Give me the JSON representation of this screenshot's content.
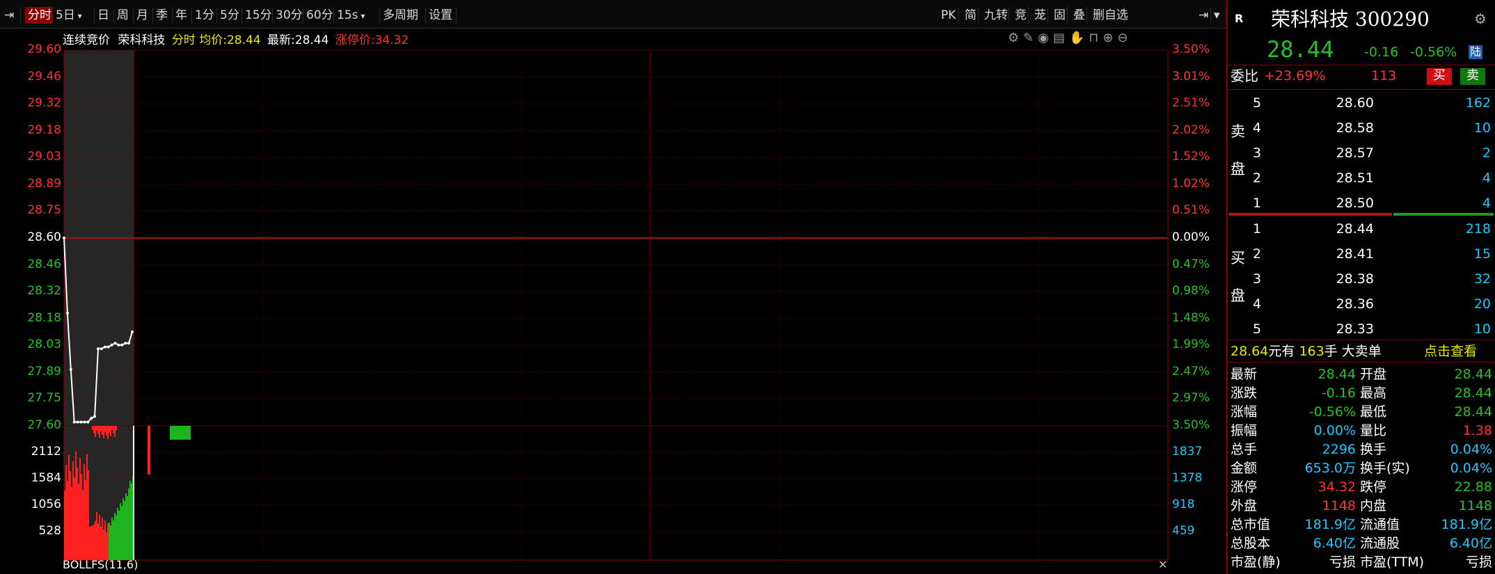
{
  "toolbar": {
    "tabs": [
      {
        "label": "分时",
        "active": true
      },
      {
        "label": "5日",
        "dropdown": true
      },
      {
        "label": "日"
      },
      {
        "label": "周"
      },
      {
        "label": "月"
      },
      {
        "label": "季"
      },
      {
        "label": "年"
      },
      {
        "label": "1分"
      },
      {
        "label": "5分"
      },
      {
        "label": "15分"
      },
      {
        "label": "30分"
      },
      {
        "label": "60分"
      },
      {
        "label": "15s",
        "dropdown": true
      },
      {
        "label": "多周期"
      },
      {
        "label": "设置"
      }
    ],
    "right_buttons": [
      "PK",
      "简",
      "九转",
      "竞",
      "茏",
      "固",
      "叠",
      "删自选"
    ]
  },
  "chart_header": {
    "auction_label": "连续竞价",
    "stock_name": "荣科科技",
    "mode": "分时",
    "avg_label": "均价:",
    "avg_value": "28.44",
    "latest_label": "最新:",
    "latest_value": "28.44",
    "limit_label": "涨停价:",
    "limit_value": "34.32"
  },
  "indicator_label": "BOLLFS(11,6)",
  "chart_data": {
    "type": "line",
    "price_axis": [
      "29.60",
      "29.46",
      "29.32",
      "29.18",
      "29.03",
      "28.89",
      "28.75",
      "28.60",
      "28.46",
      "28.32",
      "28.18",
      "28.03",
      "27.89",
      "27.75",
      "27.60"
    ],
    "pct_axis": [
      "3.50%",
      "3.01%",
      "2.51%",
      "2.02%",
      "1.52%",
      "1.02%",
      "0.51%",
      "0.00%",
      "0.47%",
      "0.98%",
      "1.48%",
      "1.99%",
      "2.47%",
      "2.97%",
      "3.50%"
    ],
    "prev_close": 28.6,
    "ylim": [
      27.6,
      29.6
    ],
    "price_series": [
      28.6,
      28.2,
      27.9,
      27.62,
      27.62,
      27.62,
      27.62,
      27.62,
      27.64,
      27.65,
      28.01,
      28.01,
      28.02,
      28.02,
      28.03,
      28.04,
      28.03,
      28.03,
      28.04,
      28.04,
      28.1
    ],
    "volume_axis_left": [
      "2112",
      "1584",
      "1056",
      "528"
    ],
    "volume_axis_right": [
      "1837",
      "1378",
      "918",
      "459"
    ],
    "volume_ylim": [
      0,
      2640
    ]
  },
  "quote": {
    "badge": "R",
    "name": "荣科科技",
    "code": "300290",
    "price": "28.44",
    "change": "-0.16",
    "change_pct": "-0.56%",
    "tag": "陆"
  },
  "order_ratio": {
    "label": "委比",
    "value": "+23.69%",
    "diff": "113",
    "buy_btn": "买",
    "sell_btn": "卖"
  },
  "sell_side": {
    "label_top": "卖",
    "label_bottom": "盘",
    "levels": [
      {
        "idx": "5",
        "price": "28.60",
        "vol": "162"
      },
      {
        "idx": "4",
        "price": "28.58",
        "vol": "10"
      },
      {
        "idx": "3",
        "price": "28.57",
        "vol": "2"
      },
      {
        "idx": "2",
        "price": "28.51",
        "vol": "4"
      },
      {
        "idx": "1",
        "price": "28.50",
        "vol": "4"
      }
    ]
  },
  "buy_side": {
    "label_top": "买",
    "label_bottom": "盘",
    "levels": [
      {
        "idx": "1",
        "price": "28.44",
        "vol": "218"
      },
      {
        "idx": "2",
        "price": "28.41",
        "vol": "15"
      },
      {
        "idx": "3",
        "price": "28.38",
        "vol": "32"
      },
      {
        "idx": "4",
        "price": "28.36",
        "vol": "20"
      },
      {
        "idx": "5",
        "price": "28.33",
        "vol": "10"
      }
    ]
  },
  "big_order": {
    "price": "28.64",
    "text1": "元有",
    "qty": "163",
    "text2": "手",
    "text3": "大卖单",
    "link": "点击查看"
  },
  "stats": [
    {
      "l1": "最新",
      "v1": "28.44",
      "c1": "green",
      "l2": "开盘",
      "v2": "28.44",
      "c2": "green"
    },
    {
      "l1": "涨跌",
      "v1": "-0.16",
      "c1": "green",
      "l2": "最高",
      "v2": "28.44",
      "c2": "green"
    },
    {
      "l1": "涨幅",
      "v1": "-0.56%",
      "c1": "green",
      "l2": "最低",
      "v2": "28.44",
      "c2": "green"
    },
    {
      "l1": "振幅",
      "v1": "0.00%",
      "c1": "cyan",
      "l2": "量比",
      "v2": "1.38",
      "c2": "red"
    },
    {
      "l1": "总手",
      "v1": "2296",
      "c1": "cyan",
      "l2": "换手",
      "v2": "0.04%",
      "c2": "cyan"
    },
    {
      "l1": "金额",
      "v1": "653.0万",
      "c1": "cyan",
      "l2": "换手(实)",
      "v2": "0.04%",
      "c2": "cyan"
    },
    {
      "l1": "涨停",
      "v1": "34.32",
      "c1": "red",
      "l2": "跌停",
      "v2": "22.88",
      "c2": "green"
    },
    {
      "l1": "外盘",
      "v1": "1148",
      "c1": "red",
      "l2": "内盘",
      "v2": "1148",
      "c2": "green"
    },
    {
      "l1": "总市值",
      "v1": "181.9亿",
      "c1": "cyan",
      "l2": "流通值",
      "v2": "181.9亿",
      "c2": "cyan"
    },
    {
      "l1": "总股本",
      "v1": "6.40亿",
      "c1": "cyan",
      "l2": "流通股",
      "v2": "6.40亿",
      "c2": "cyan"
    },
    {
      "l1": "市盈(静)",
      "v1": "亏损",
      "c1": "white",
      "l2": "市盈(TTM)",
      "v2": "亏损",
      "c2": "white"
    }
  ],
  "colors": {
    "up": "#ff3333",
    "down": "#22c322",
    "grid": "#8b0000",
    "bg": "#000000"
  }
}
